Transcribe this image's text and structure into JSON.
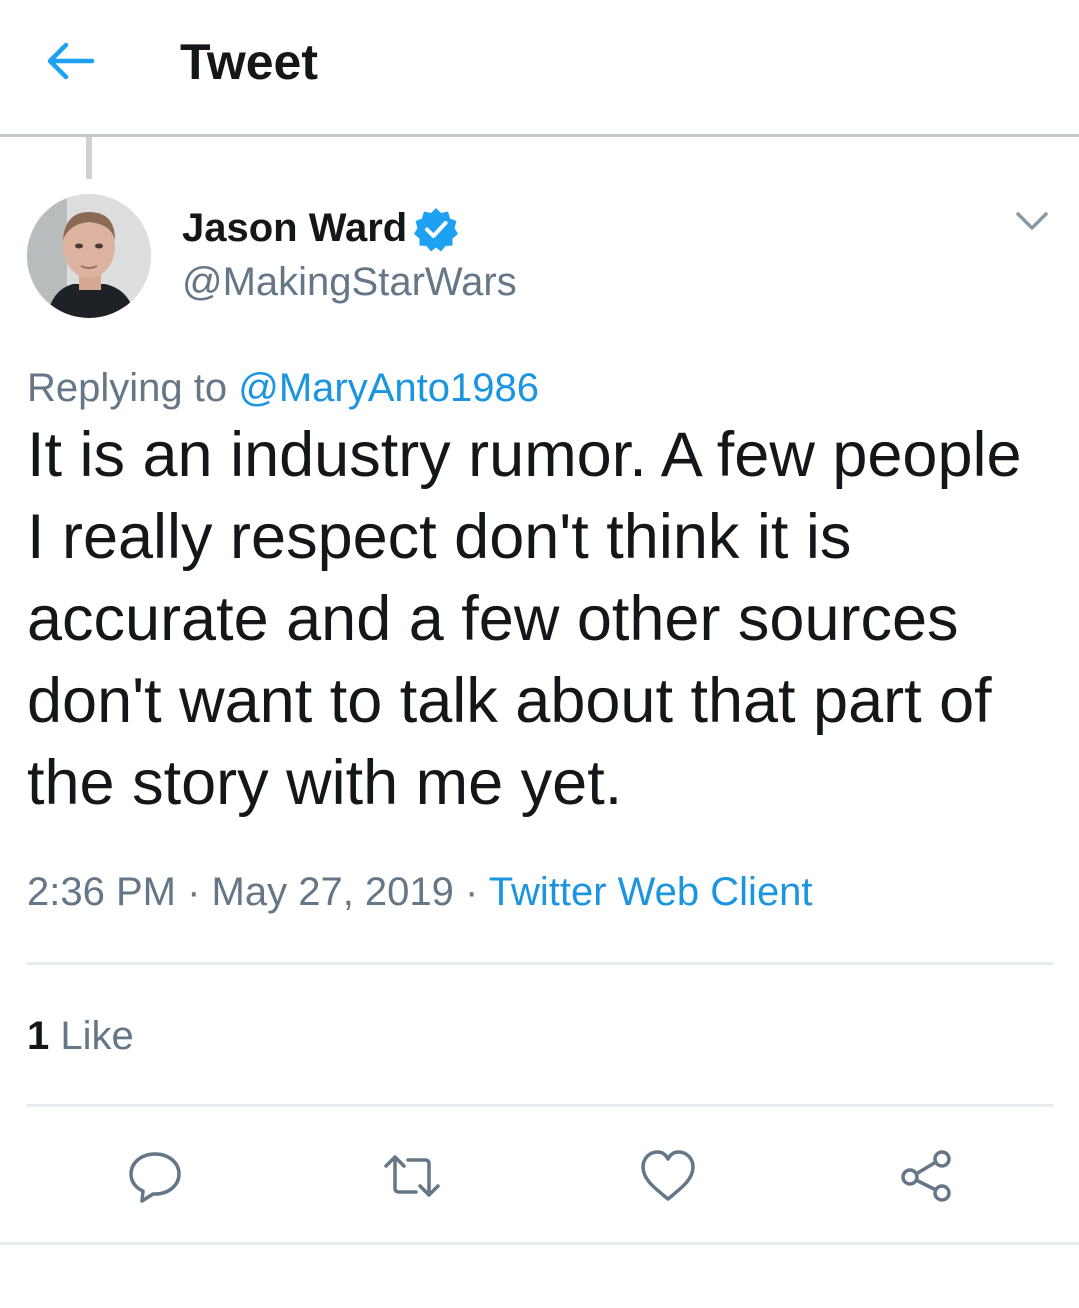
{
  "header": {
    "title": "Tweet",
    "back_icon": "back-arrow-icon",
    "accent": "#1da1f2"
  },
  "author": {
    "name": "Jason Ward",
    "handle": "@MakingStarWars",
    "verified_icon": "verified-badge-icon"
  },
  "reply": {
    "prefix": "Replying to ",
    "mention": "@MaryAnto1986"
  },
  "tweet": {
    "lines": [
      "It is an industry rumor. A few people",
      "I really respect don't think it is",
      "accurate and a few other sources",
      "don't want to talk about that part of",
      "the story with me yet."
    ]
  },
  "meta": {
    "time": "2:36 PM",
    "sep1": " · ",
    "date": "May 27, 2019",
    "sep2": " · ",
    "client": "Twitter Web Client"
  },
  "stats": {
    "like_count": "1",
    "like_label": " Like"
  },
  "actions": [
    "reply-icon",
    "retweet-icon",
    "like-icon",
    "share-icon"
  ],
  "colors": {
    "text": "#14171a",
    "secondary": "#657786",
    "link": "#1b95e0"
  }
}
